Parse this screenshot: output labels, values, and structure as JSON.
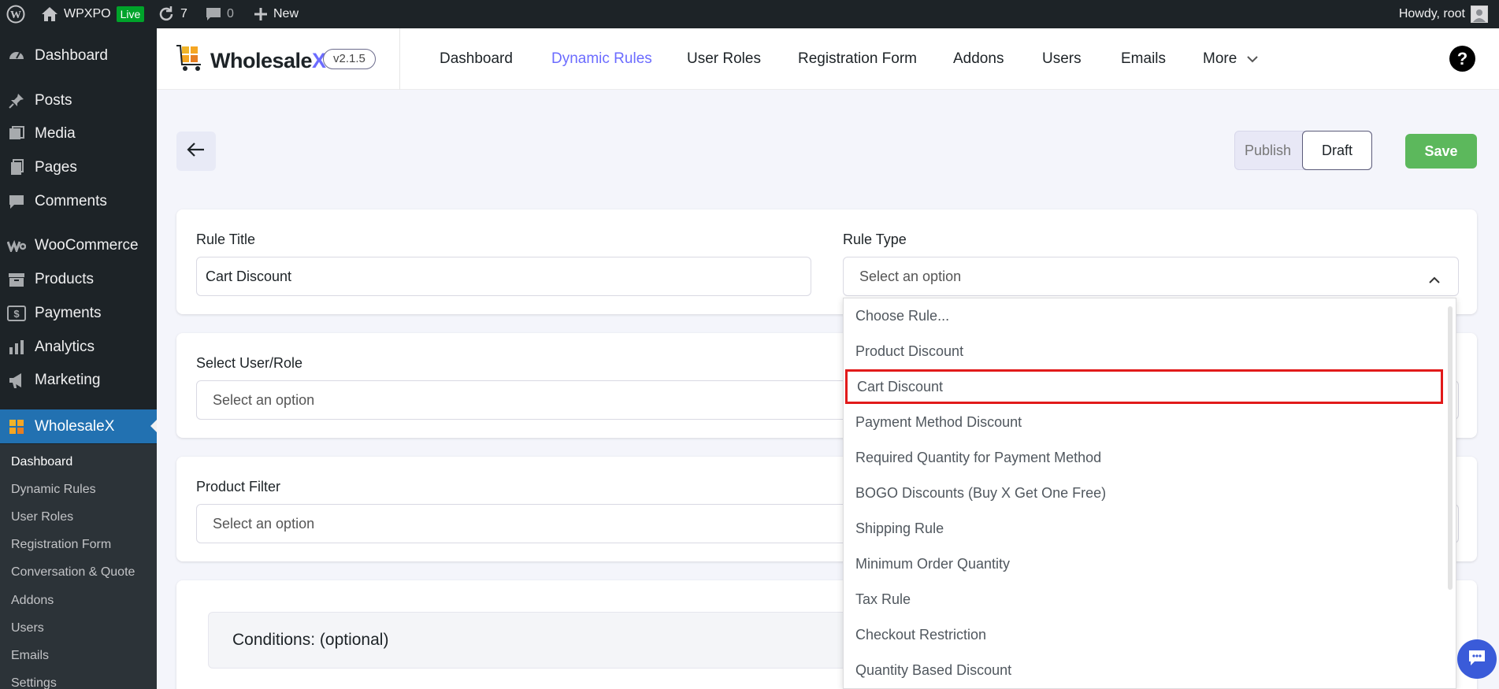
{
  "adminbar": {
    "site_name": "WPXPO",
    "live_badge": "Live",
    "updates_count": "7",
    "comments_count": "0",
    "new_label": "New",
    "greeting": "Howdy, root"
  },
  "sidebar": {
    "items": [
      {
        "label": "Dashboard",
        "icon": "gauge-icon"
      },
      {
        "label": "Posts",
        "icon": "pin-icon"
      },
      {
        "label": "Media",
        "icon": "media-icon"
      },
      {
        "label": "Pages",
        "icon": "pages-icon"
      },
      {
        "label": "Comments",
        "icon": "comment-icon"
      },
      {
        "label": "WooCommerce",
        "icon": "woo-icon"
      },
      {
        "label": "Products",
        "icon": "archive-icon"
      },
      {
        "label": "Payments",
        "icon": "dollar-icon"
      },
      {
        "label": "Analytics",
        "icon": "bar-chart-icon"
      },
      {
        "label": "Marketing",
        "icon": "megaphone-icon"
      },
      {
        "label": "WholesaleX",
        "icon": "wholesalex-icon"
      }
    ],
    "submenu": [
      "Dashboard",
      "Dynamic Rules",
      "User Roles",
      "Registration Form",
      "Conversation & Quote",
      "Addons",
      "Users",
      "Emails",
      "Settings"
    ]
  },
  "topnav": {
    "brand": "Wholesale",
    "brand_x": "X",
    "version": "v2.1.5",
    "links": [
      "Dashboard",
      "Dynamic Rules",
      "User Roles",
      "Registration Form",
      "Addons",
      "Users",
      "Emails",
      "More"
    ],
    "active_link": "Dynamic Rules",
    "help": "?"
  },
  "actions": {
    "publish": "Publish",
    "draft": "Draft",
    "save": "Save",
    "save_color": "#5cb85c"
  },
  "form": {
    "rule_title_label": "Rule Title",
    "rule_title_value": "Cart Discount",
    "rule_type_label": "Rule Type",
    "rule_type_placeholder": "Select an option",
    "user_role_label": "Select User/Role",
    "user_role_placeholder": "Select an option",
    "product_filter_label": "Product Filter",
    "product_filter_placeholder": "Select an option",
    "conditions_label": "Conditions: (optional)"
  },
  "dropdown": {
    "options": [
      "Choose Rule...",
      "Product Discount",
      "Cart Discount",
      "Payment Method Discount",
      "Required Quantity for Payment Method",
      "BOGO Discounts (Buy X Get One Free)",
      "Shipping Rule",
      "Minimum Order Quantity",
      "Tax Rule",
      "Checkout Restriction",
      "Quantity Based Discount"
    ],
    "highlighted": "Cart Discount",
    "highlight_color": "#e11a1a"
  },
  "colors": {
    "accent": "#6c6cff",
    "wp_blue": "#2271b1",
    "admin_dark": "#1d2327"
  }
}
